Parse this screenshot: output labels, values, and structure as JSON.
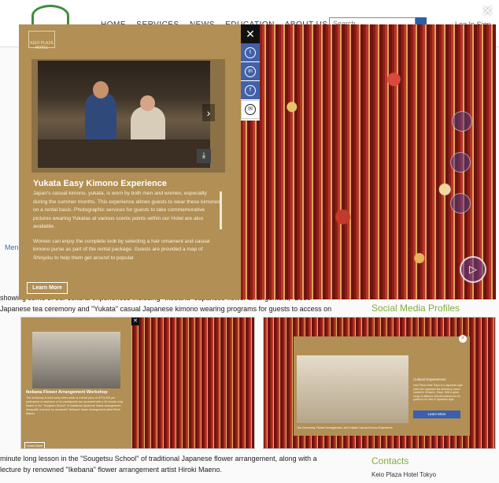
{
  "colors": {
    "panel_gold": "#b18f55",
    "accent_blue": "#4261a8",
    "social_green": "#7fae3b"
  },
  "background_page": {
    "nav": [
      "HOME",
      "SERVICES",
      "NEWS",
      "EDUCATION",
      "ABOUT US"
    ],
    "search_placeholder": "Search",
    "login": "Log In  Sign Up",
    "left_fragments": [
      "Menu",
      "Social Media Profiles"
    ],
    "body_lines": [
      "showing some of our cultural experiences including \"Ikebana\" Japanese flower arrangement, \"Boso",
      "Japanese tea ceremony and \"Yukata\" casual Japanese kimono wearing programs for guests to access on",
      "minute long lesson in the \"Sougetsu School\" of traditional Japanese flower arrangement, along with a",
      "lecture by renowned \"Ikebana\" flower arrangement artist Hiroki Maeno."
    ],
    "contacts_head": "Contacts",
    "contacts_line": "Keio Plaza Hotel Tokyo"
  },
  "main_modal": {
    "logo_text": "KEIO PLAZA HOTEL",
    "title": "Yukata Easy Kimono Experience",
    "body_p1": "Japan's casual kimono, yukata, is worn by both men and women, especially during the summer months. This experience allows guests to wear these kimonos on a rental basis. Photographic services for guests to take commemorative pictures wearing Yukatas at various scenic points within our Hotel are also available.",
    "body_p2": "Women can enjoy the complete look by selecting a hair ornament and casual kimono purse as part of the rental package. Guests are provided a map of Shinjuku to help them get around to popular",
    "learn_more": "Learn More",
    "close_symbol": "✕",
    "arrow_symbol": "›",
    "download_symbol": "⤓",
    "share": {
      "twitter": "t",
      "linkedin": "in",
      "facebook": "f",
      "email": "✉"
    }
  },
  "thumbnail_left": {
    "title": "Ikebana Flower Arrangement Workshop",
    "body": "The workshop is held every other week at a fixed price of JPY3,000 per participant. A maximum of six participants are accepted with a 30-minute long lesson in the \"Sougetsu School\" of traditional Japanese flower arrangement, along with a lecture by renowned \"Ikebana\" flower arrangement artist Hiroki Maeno.",
    "learn_more": "Learn More"
  },
  "thumbnail_right": {
    "heading": "Cultural Experiences",
    "body": "Keio Plaza Hotel Tokyo is a Japanese-style hotel and Japanese tea ceremony rooms located in Shinjuku, Tokyo. With a great range of different cultural experiences for guests to be held in Japanese style.",
    "learn_more": "Learn More",
    "caption": "Tea Ceremony, Flower Arrangement, and Yukata Casual Kimono Experience"
  }
}
